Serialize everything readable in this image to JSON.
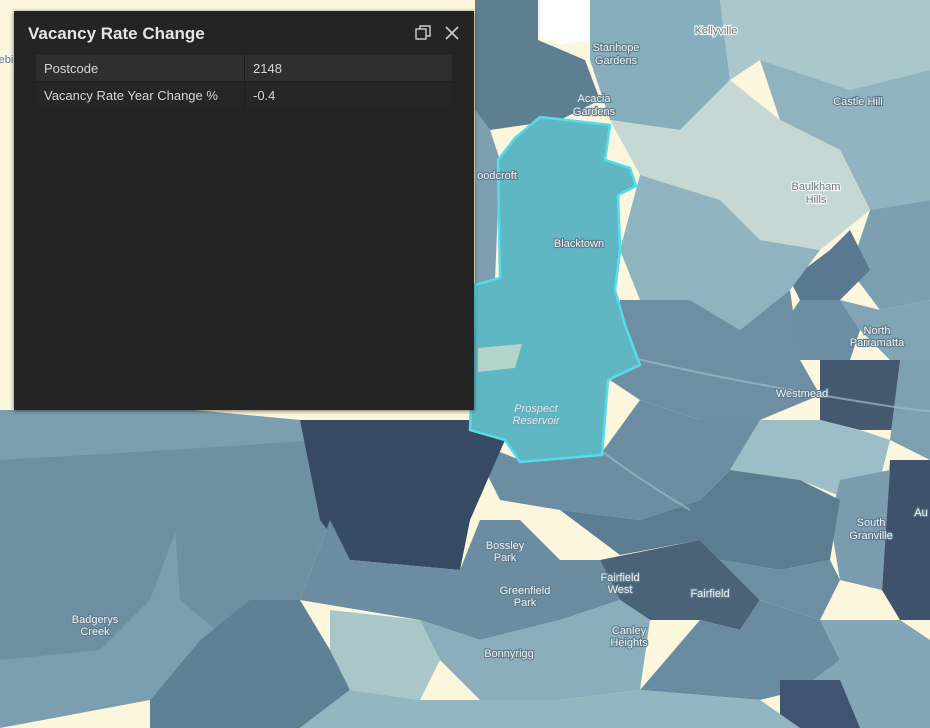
{
  "popup": {
    "title": "Vacancy Rate Change",
    "dock_icon": "dock-icon",
    "close_icon": "close-icon",
    "rows": [
      {
        "field": "Postcode",
        "value": "2148"
      },
      {
        "field": "Vacancy Rate Year Change %",
        "value": "-0.4"
      }
    ]
  },
  "map": {
    "selected_postcode": "2148",
    "colors": {
      "background": "#fbf6dc",
      "selected_fill": "#5fb7c4",
      "selected_outline": "#55dcec",
      "darkest": "#374a63"
    },
    "labels": [
      {
        "text": "Kellyville"
      },
      {
        "text": "Stanhope",
        "line2": "Gardens"
      },
      {
        "text": "Acacia",
        "line2": "Gardens"
      },
      {
        "text": "Castle Hill"
      },
      {
        "text": "Baulkham",
        "line2": "Hills"
      },
      {
        "text": "oodcroft"
      },
      {
        "text": "Blacktown"
      },
      {
        "text": "North",
        "line2": "Parramatta"
      },
      {
        "text": "Westmead"
      },
      {
        "text": "Prospect",
        "line2": "Reservoir"
      },
      {
        "text": "Bossley",
        "line2": "Park"
      },
      {
        "text": "Greenfield",
        "line2": "Park"
      },
      {
        "text": "Fairfield",
        "line2": "West"
      },
      {
        "text": "Fairfield"
      },
      {
        "text": "Canley",
        "line2": "Heights"
      },
      {
        "text": "Badgerys",
        "line2": "Creek"
      },
      {
        "text": "South",
        "line2": "Granville"
      },
      {
        "text": "Bonnyrigg"
      },
      {
        "text": "Au"
      },
      {
        "text": "ebi"
      }
    ]
  }
}
